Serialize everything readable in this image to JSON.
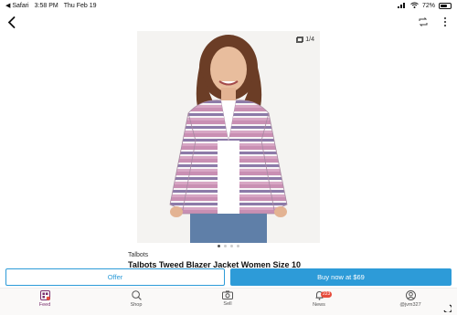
{
  "status_bar": {
    "back_app": "◀ Safari",
    "time": "3:58 PM",
    "date": "Thu Feb 19",
    "battery": "72%",
    "battery_level": 0.72
  },
  "nav": {
    "back_icon": "chevron-left-icon",
    "share_icon": "share-icon",
    "more_icon": "more-icon"
  },
  "photo": {
    "counter": "1/4",
    "counter_icon": "photos-icon"
  },
  "product": {
    "brand": "Talbots",
    "title": "Talbots Tweed Blazer Jacket Women Size 10"
  },
  "actions": {
    "offer_label": "Offer",
    "buy_label": "Buy now at $69"
  },
  "tabs": [
    {
      "label": "Feed",
      "icon": "feed-icon",
      "active": true
    },
    {
      "label": "Shop",
      "icon": "search-icon",
      "active": false
    },
    {
      "label": "Sell",
      "icon": "camera-icon",
      "active": false
    },
    {
      "label": "News",
      "icon": "bell-icon",
      "active": false,
      "badge": "223"
    },
    {
      "label": "@jvm327",
      "icon": "profile-icon",
      "active": false
    }
  ],
  "colors": {
    "accent": "#2d9bd8",
    "active_tab": "#7b2f6f",
    "badge": "#e74c3c"
  }
}
